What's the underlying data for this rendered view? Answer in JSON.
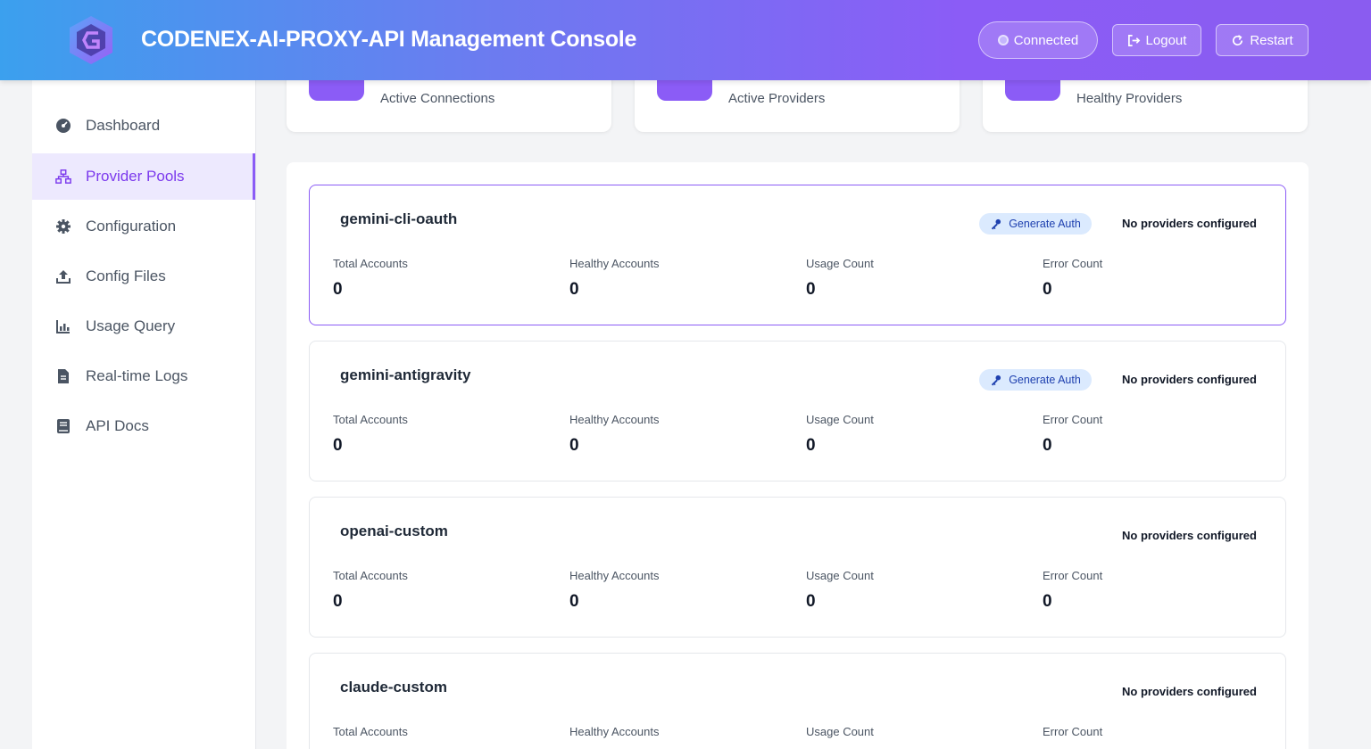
{
  "header": {
    "title": "CODENEX-AI-PROXY-API Management Console",
    "connected_label": "Connected",
    "logout_label": "Logout",
    "restart_label": "Restart"
  },
  "sidebar": {
    "items": [
      {
        "label": "Dashboard",
        "icon": "gauge-icon"
      },
      {
        "label": "Provider Pools",
        "icon": "network-icon",
        "active": true
      },
      {
        "label": "Configuration",
        "icon": "gear-icon"
      },
      {
        "label": "Config Files",
        "icon": "upload-icon"
      },
      {
        "label": "Usage Query",
        "icon": "chart-icon"
      },
      {
        "label": "Real-time Logs",
        "icon": "file-icon"
      },
      {
        "label": "API Docs",
        "icon": "book-icon"
      }
    ]
  },
  "stats": [
    {
      "label": "Active Connections"
    },
    {
      "label": "Active Providers"
    },
    {
      "label": "Healthy Providers"
    }
  ],
  "pools": [
    {
      "name": "gemini-cli-oauth",
      "generate_auth": "Generate Auth",
      "status": "No providers configured",
      "metrics": [
        {
          "label": "Total Accounts",
          "value": "0"
        },
        {
          "label": "Healthy Accounts",
          "value": "0"
        },
        {
          "label": "Usage Count",
          "value": "0"
        },
        {
          "label": "Error Count",
          "value": "0"
        }
      ]
    },
    {
      "name": "gemini-antigravity",
      "generate_auth": "Generate Auth",
      "status": "No providers configured",
      "metrics": [
        {
          "label": "Total Accounts",
          "value": "0"
        },
        {
          "label": "Healthy Accounts",
          "value": "0"
        },
        {
          "label": "Usage Count",
          "value": "0"
        },
        {
          "label": "Error Count",
          "value": "0"
        }
      ]
    },
    {
      "name": "openai-custom",
      "status": "No providers configured",
      "metrics": [
        {
          "label": "Total Accounts",
          "value": "0"
        },
        {
          "label": "Healthy Accounts",
          "value": "0"
        },
        {
          "label": "Usage Count",
          "value": "0"
        },
        {
          "label": "Error Count",
          "value": "0"
        }
      ]
    },
    {
      "name": "claude-custom",
      "status": "No providers configured",
      "metrics": [
        {
          "label": "Total Accounts"
        },
        {
          "label": "Healthy Accounts"
        },
        {
          "label": "Usage Count"
        },
        {
          "label": "Error Count"
        }
      ]
    }
  ],
  "colors": {
    "accent": "#8b5cf6",
    "header_start": "#3ba0ee",
    "header_end": "#8a5cf0",
    "active_nav_bg": "#ede9fe",
    "badge_bg": "#dbeafe"
  }
}
